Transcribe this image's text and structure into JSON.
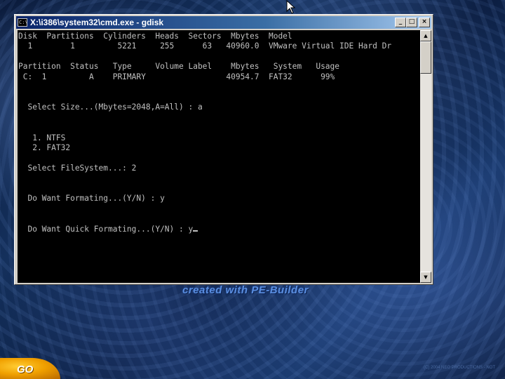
{
  "window": {
    "title": "X:\\i386\\system32\\cmd.exe - gdisk",
    "buttons": {
      "minimize": "_",
      "maximize": "□",
      "close": "×"
    }
  },
  "console": {
    "lines": [
      "Disk  Partitions  Cylinders  Heads  Sectors  Mbytes  Model",
      "  1        1         5221     255      63   40960.0  VMware Virtual IDE Hard Dr",
      "",
      "Partition  Status   Type     Volume Label    Mbytes   System   Usage",
      " C:  1         A    PRIMARY                 40954.7  FAT32      99%",
      "",
      "",
      "  Select Size...(Mbytes=2048,A=All) : a",
      "",
      "",
      "   1. NTFS",
      "   2. FAT32",
      "",
      "  Select FileSystem...: 2",
      "",
      "",
      "  Do Want Formating...(Y/N) : y",
      "",
      "",
      "  Do Want Quick Formating...(Y/N) : y"
    ]
  },
  "desktop": {
    "brand_text": "created with PE-Builder",
    "start_button": "GO",
    "copyright": "(C) 2004 NEO PRODUCTIONS - NOT"
  }
}
